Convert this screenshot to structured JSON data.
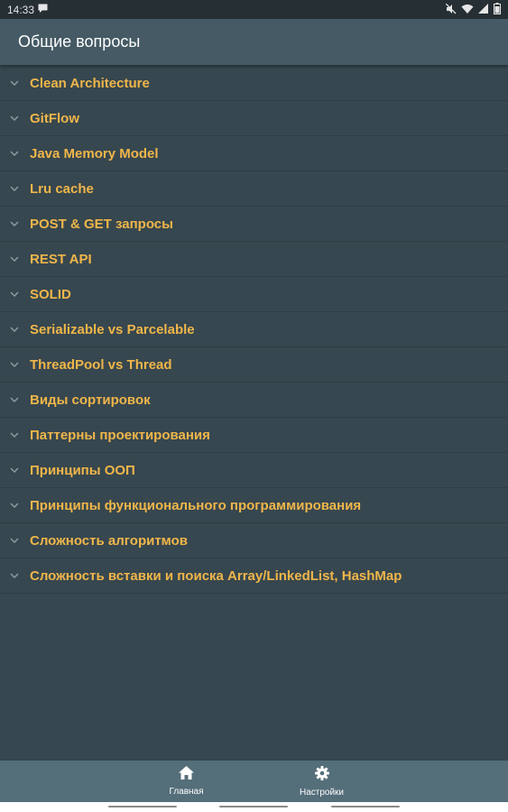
{
  "status_bar": {
    "time": "14:33",
    "icons": [
      "message-icon",
      "mute-icon",
      "wifi-icon",
      "signal-icon",
      "battery-icon"
    ]
  },
  "app_bar": {
    "title": "Общие вопросы"
  },
  "list": {
    "items": [
      "Clean Architecture",
      "GitFlow",
      "Java Memory Model",
      "Lru cache",
      "POST & GET запросы",
      "REST API",
      "SOLID",
      "Serializable vs Parcelable",
      "ThreadPool vs Thread",
      "Виды сортировок",
      "Паттерны проектирования",
      "Принципы ООП",
      "Принципы функционального программирования",
      "Сложность алгоритмов",
      "Сложность вставки и поиска Array/LinkedList, HashMap"
    ]
  },
  "bottom_nav": {
    "home_label": "Главная",
    "settings_label": "Настройки"
  },
  "colors": {
    "background": "#37474f",
    "app_bar": "#455a64",
    "accent_text": "#f0b64a",
    "bottom_nav": "#546e7a"
  }
}
